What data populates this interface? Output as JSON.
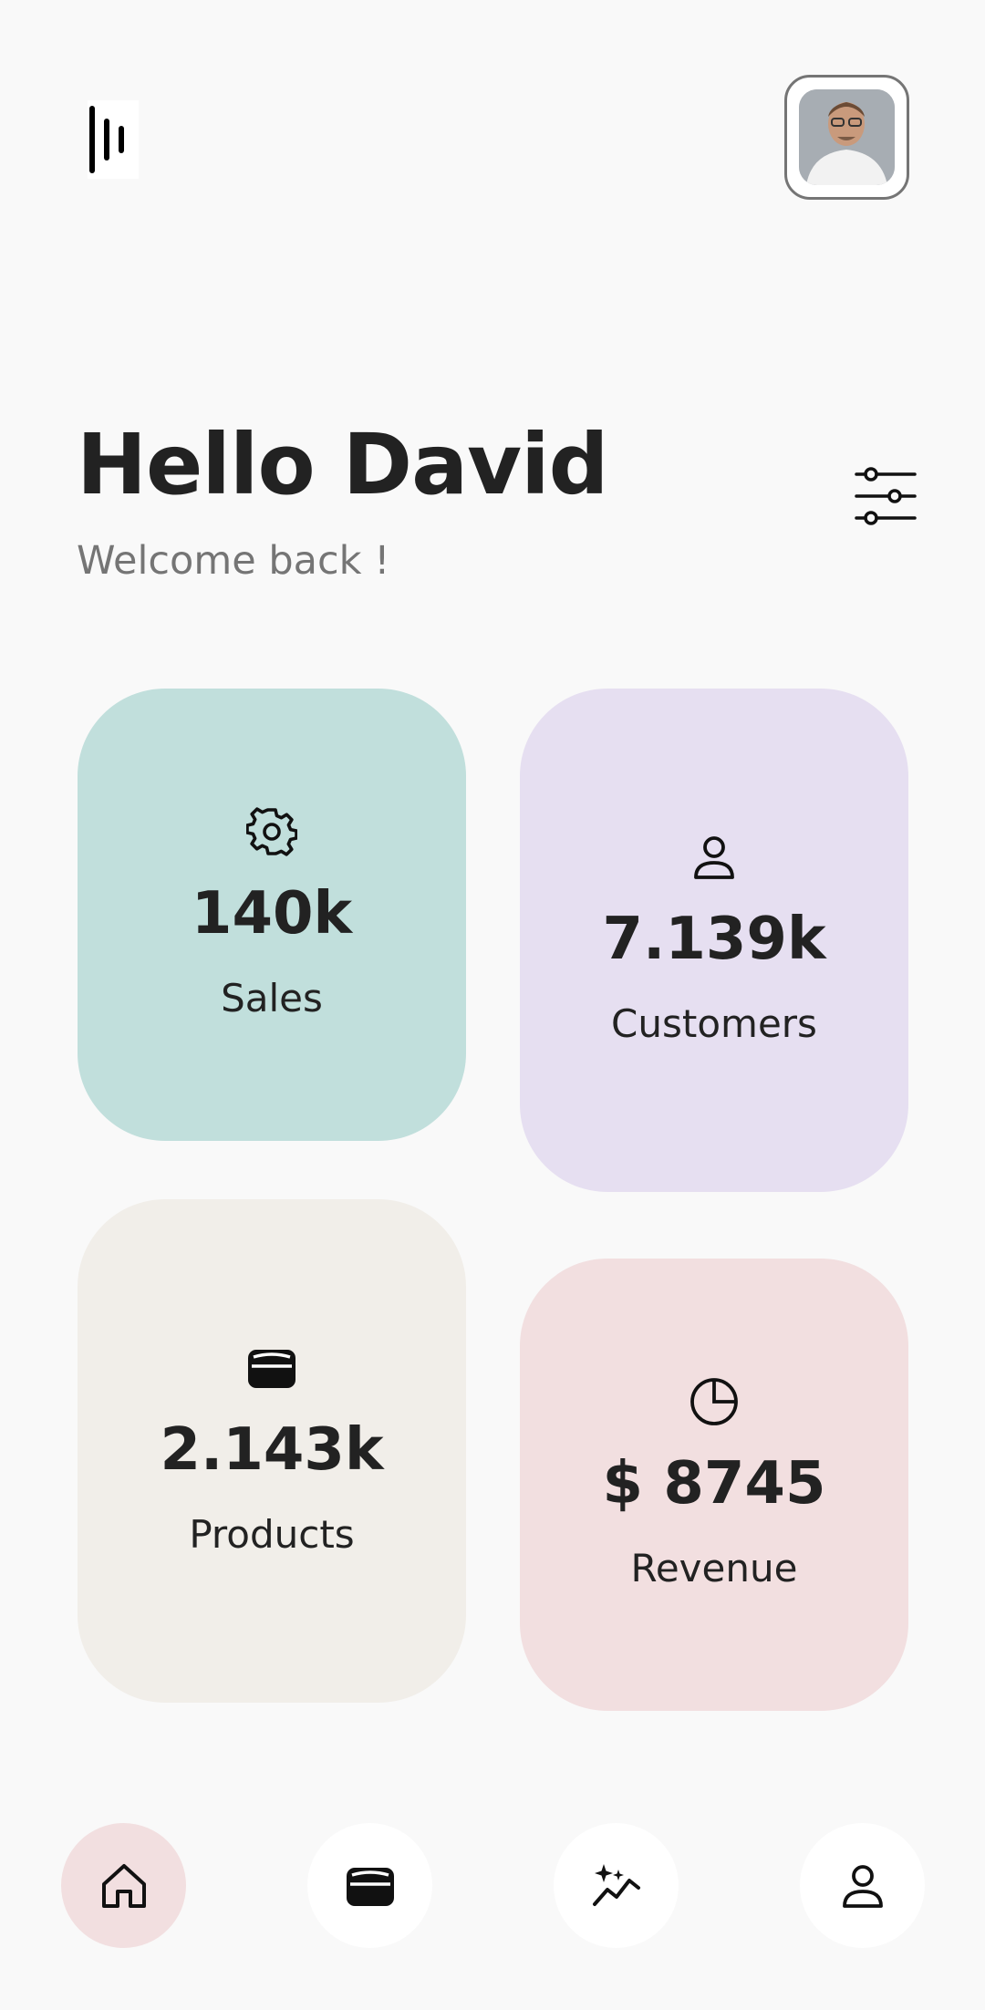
{
  "header": {
    "logo_icon": "sound-bars-logo",
    "avatar_icon": "user-photo"
  },
  "greeting": {
    "title": "Hello David",
    "subtitle": "Welcome back !",
    "filter_icon": "sliders-icon"
  },
  "stats": [
    {
      "icon": "gear-icon",
      "value": "140k",
      "label": "Sales",
      "color": "#c1dfdc"
    },
    {
      "icon": "person-icon",
      "value": "7.139k",
      "label": "Customers",
      "color": "#e6dff1"
    },
    {
      "icon": "wallet-icon",
      "value": "2.143k",
      "label": "Products",
      "color": "#f1eee9"
    },
    {
      "icon": "pie-chart-icon",
      "value": "$ 8745",
      "label": "Revenue",
      "color": "#f2dfe0"
    }
  ],
  "bottom_nav": [
    {
      "icon": "home-icon",
      "active": true
    },
    {
      "icon": "wallet-icon",
      "active": false
    },
    {
      "icon": "sparkle-chart-icon",
      "active": false
    },
    {
      "icon": "person-icon",
      "active": false
    }
  ],
  "colors": {
    "background": "#f9f9f9",
    "active_nav": "#f2dfe0",
    "text": "#222222",
    "muted": "#757575"
  }
}
